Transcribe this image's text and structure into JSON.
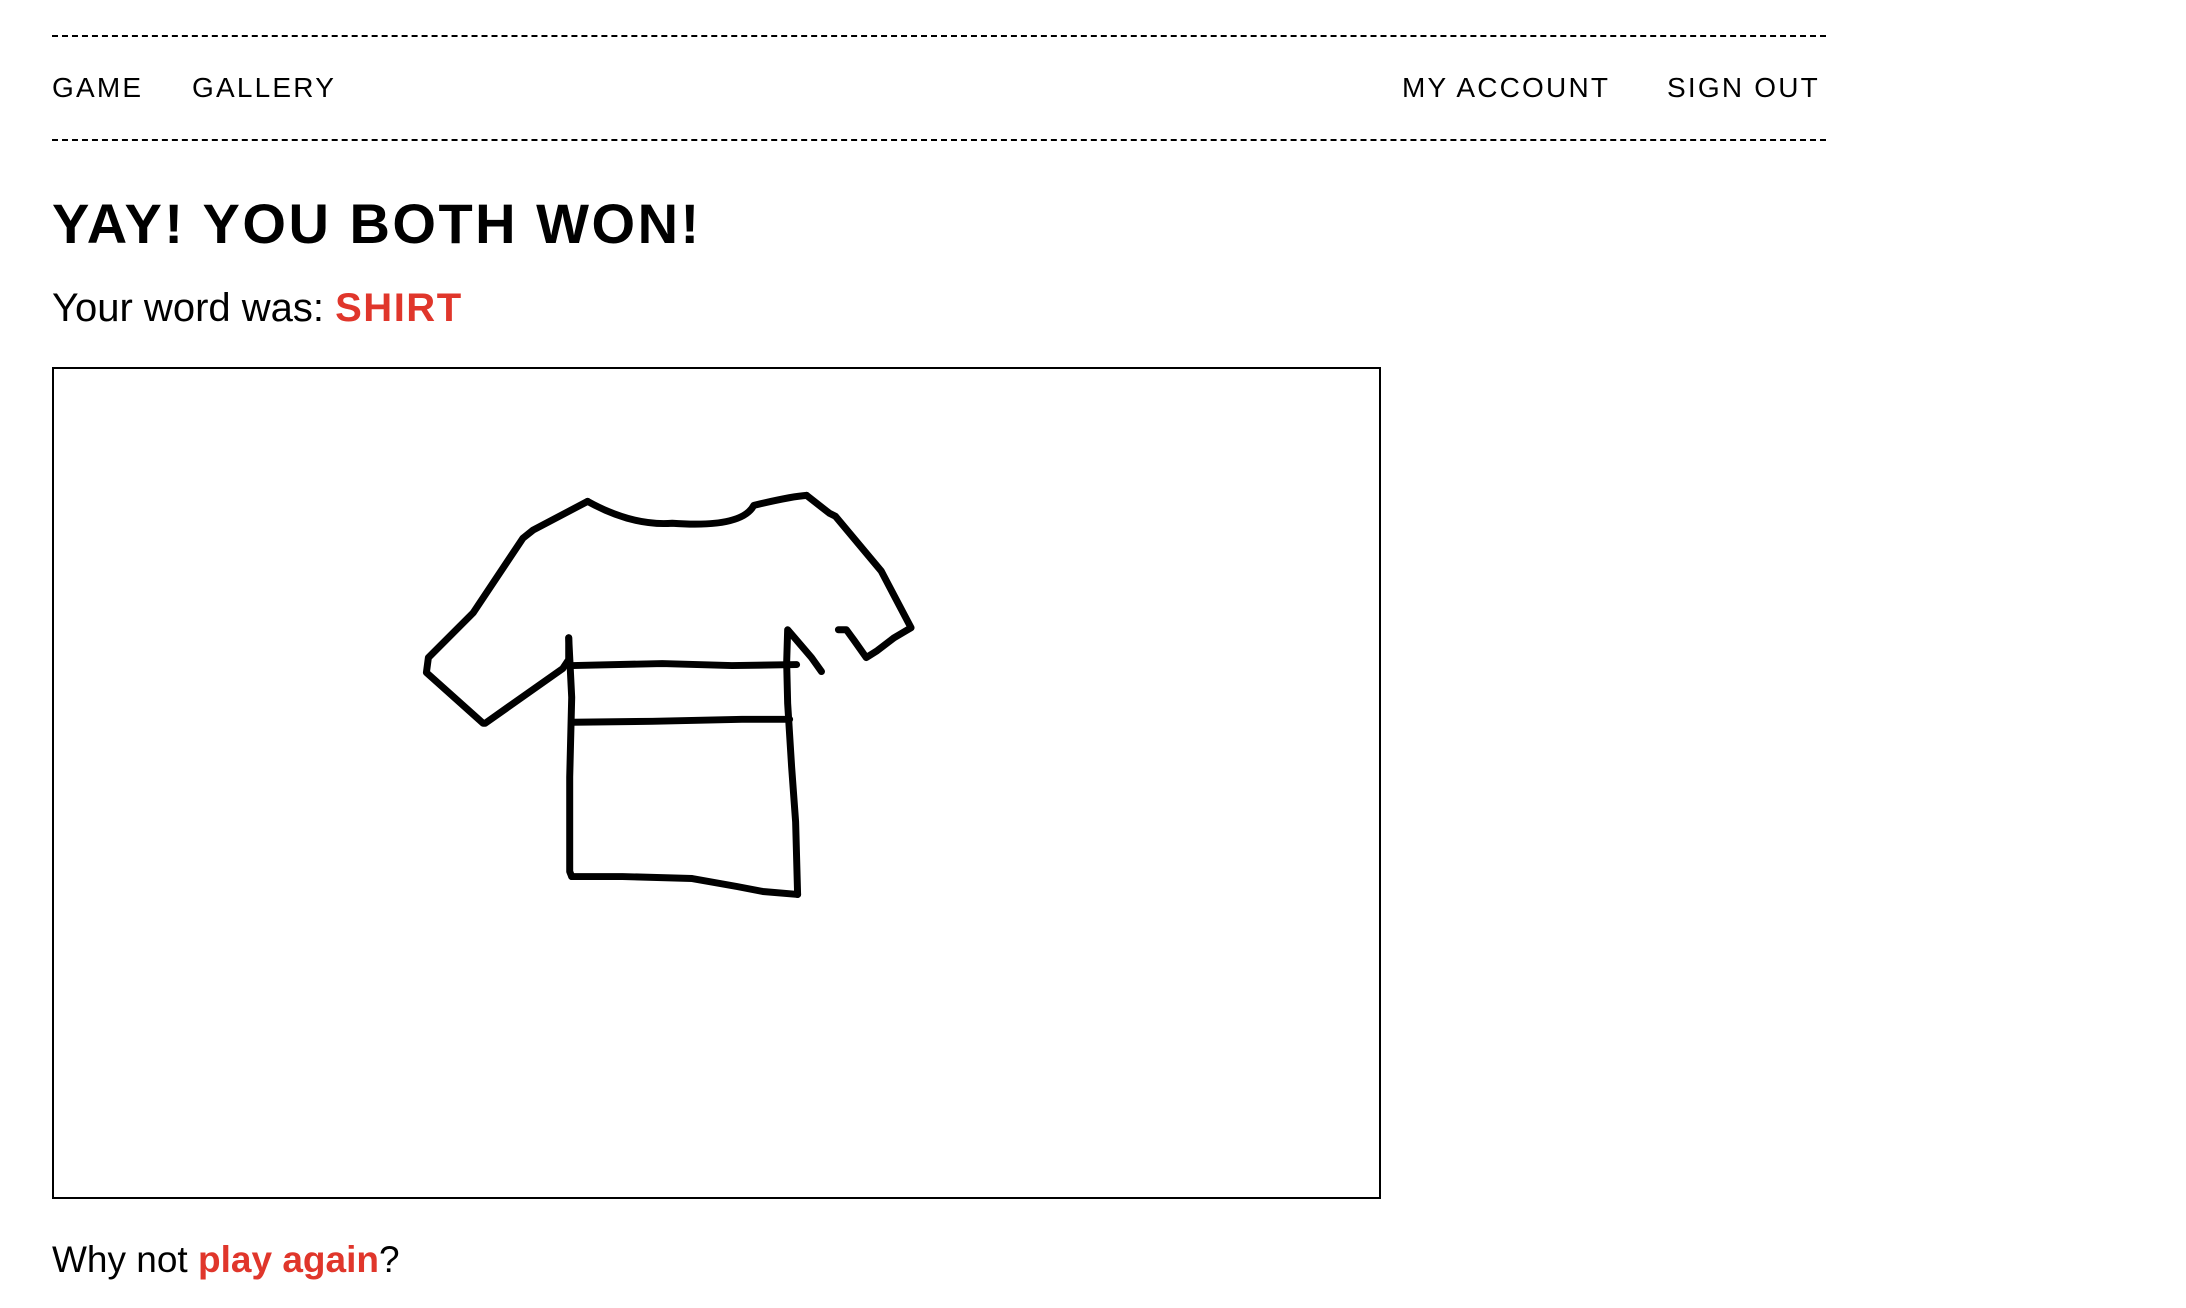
{
  "nav": {
    "left": [
      {
        "label": "GAME"
      },
      {
        "label": "GALLERY"
      }
    ],
    "right": [
      {
        "label": "MY ACCOUNT"
      },
      {
        "label": "SIGN OUT"
      }
    ]
  },
  "result": {
    "heading": "YAY! YOU BOTH WON!",
    "word_prefix": "Your word was:",
    "word": "SHIRT"
  },
  "drawing": {
    "subject": "shirt",
    "stroke_color": "#000000"
  },
  "footer": {
    "prefix": "Why not",
    "link": "play again",
    "suffix": "?"
  },
  "colors": {
    "accent": "#e0362b",
    "text": "#000000",
    "background": "#ffffff"
  }
}
